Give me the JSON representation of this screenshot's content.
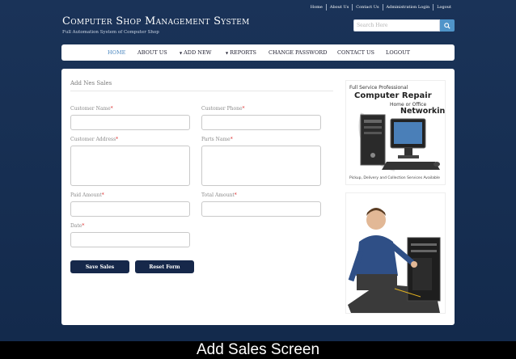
{
  "top_links": [
    "Home",
    "About Us",
    "Contact Us",
    "Administration Login",
    "Logout"
  ],
  "brand": {
    "title": "Computer Shop Management System",
    "subtitle": "Full Automation System of Computer Shop"
  },
  "search": {
    "placeholder": "Search Here"
  },
  "nav": {
    "home": "HOME",
    "about": "ABOUT US",
    "add_new": "ADD NEW",
    "reports": "REPORTS",
    "change_password": "CHANGE PASSWORD",
    "contact": "CONTACT US",
    "logout": "LOGOUT"
  },
  "form": {
    "title": "Add Nes Sales",
    "required_mark": "*",
    "customer_name": "Customer Name",
    "customer_phone": "Customer Phone",
    "customer_address": "Customer Address",
    "parts_name": "Parts Name",
    "paid_amount": "Paid Amount",
    "total_amount": "Total Amount",
    "date": "Date",
    "save_label": "Save Sales",
    "reset_label": "Reset Form"
  },
  "ad": {
    "line1": "Full Service Professional",
    "line2": "Computer Repair",
    "line3": "Home or Office",
    "line4": "Networking",
    "line5": "Pickup, Delivery and Collection Services Available"
  },
  "caption": "Add Sales Screen",
  "colors": {
    "background": "#142b4f",
    "nav_active": "#4b87c0",
    "search_button": "#4f94c9",
    "button_dark": "#16284a",
    "required": "#dd3333"
  }
}
